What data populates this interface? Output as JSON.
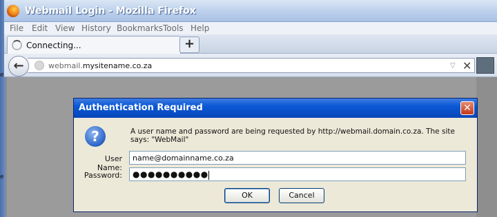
{
  "window": {
    "title": "Webmail Login - Mozilla Firefox"
  },
  "menu": [
    "File",
    "Edit",
    "View",
    "History",
    "Bookmarks",
    "Tools",
    "Help"
  ],
  "tab": {
    "label": "Connecting...",
    "new_tab_label": "+"
  },
  "nav": {
    "url_prefix": "webmail.",
    "url_domain": "mysitename.co.za",
    "back_label": "←",
    "stop_label": "✕",
    "dropdown_label": "▽"
  },
  "dialog": {
    "title": "Authentication Required",
    "close_label": "✕",
    "icon_glyph": "?",
    "message": "A user name and password are being requested by http://webmail.domain.co.za. The site says: \"WebMail\"",
    "username_label": "User Name:",
    "username_value": "name@domainname.co.za",
    "password_label": "Password:",
    "password_value": "●●●●●●●●●●",
    "ok_label": "OK",
    "cancel_label": "Cancel"
  },
  "edge_text": [
    "e",
    "e"
  ]
}
